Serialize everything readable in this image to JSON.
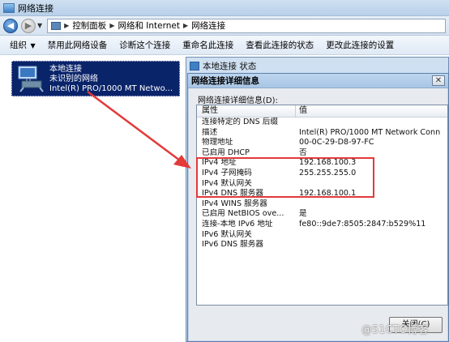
{
  "window": {
    "title": "网络连接"
  },
  "address": {
    "crumbs": [
      "控制面板",
      "网络和 Internet",
      "网络连接"
    ]
  },
  "toolbar": {
    "organize": "组织",
    "disable": "禁用此网络设备",
    "diagnose": "诊断这个连接",
    "rename": "重命名此连接",
    "view_status": "查看此连接的状态",
    "change_settings": "更改此连接的设置"
  },
  "connection": {
    "name": "本地连接",
    "status": "未识别的网络",
    "adapter": "Intel(R) PRO/1000 MT Netwo..."
  },
  "status_window": {
    "title": "本地连接 状态"
  },
  "details_dialog": {
    "title": "网络连接详细信息",
    "label": "网络连接详细信息(D):",
    "columns": [
      "属性",
      "值"
    ],
    "rows": [
      [
        "连接特定的 DNS 后缀",
        ""
      ],
      [
        "描述",
        "Intel(R) PRO/1000 MT Network Conn"
      ],
      [
        "物理地址",
        "00-0C-29-D8-97-FC"
      ],
      [
        "已启用 DHCP",
        "否"
      ],
      [
        "IPv4 地址",
        "192.168.100.3"
      ],
      [
        "IPv4 子网掩码",
        "255.255.255.0"
      ],
      [
        "IPv4 默认网关",
        ""
      ],
      [
        "IPv4 DNS 服务器",
        "192.168.100.1"
      ],
      [
        "IPv4 WINS 服务器",
        ""
      ],
      [
        "已启用 NetBIOS ove...",
        "是"
      ],
      [
        "连接-本地 IPv6 地址",
        "fe80::9de7:8505:2847:b529%11"
      ],
      [
        "IPv6 默认网关",
        ""
      ],
      [
        "IPv6 DNS 服务器",
        ""
      ]
    ],
    "close_label": "关闭(C)"
  },
  "watermark": "@51CTO博客",
  "colors": {
    "highlight": "#e33a3a",
    "selection": "#0a246a"
  }
}
